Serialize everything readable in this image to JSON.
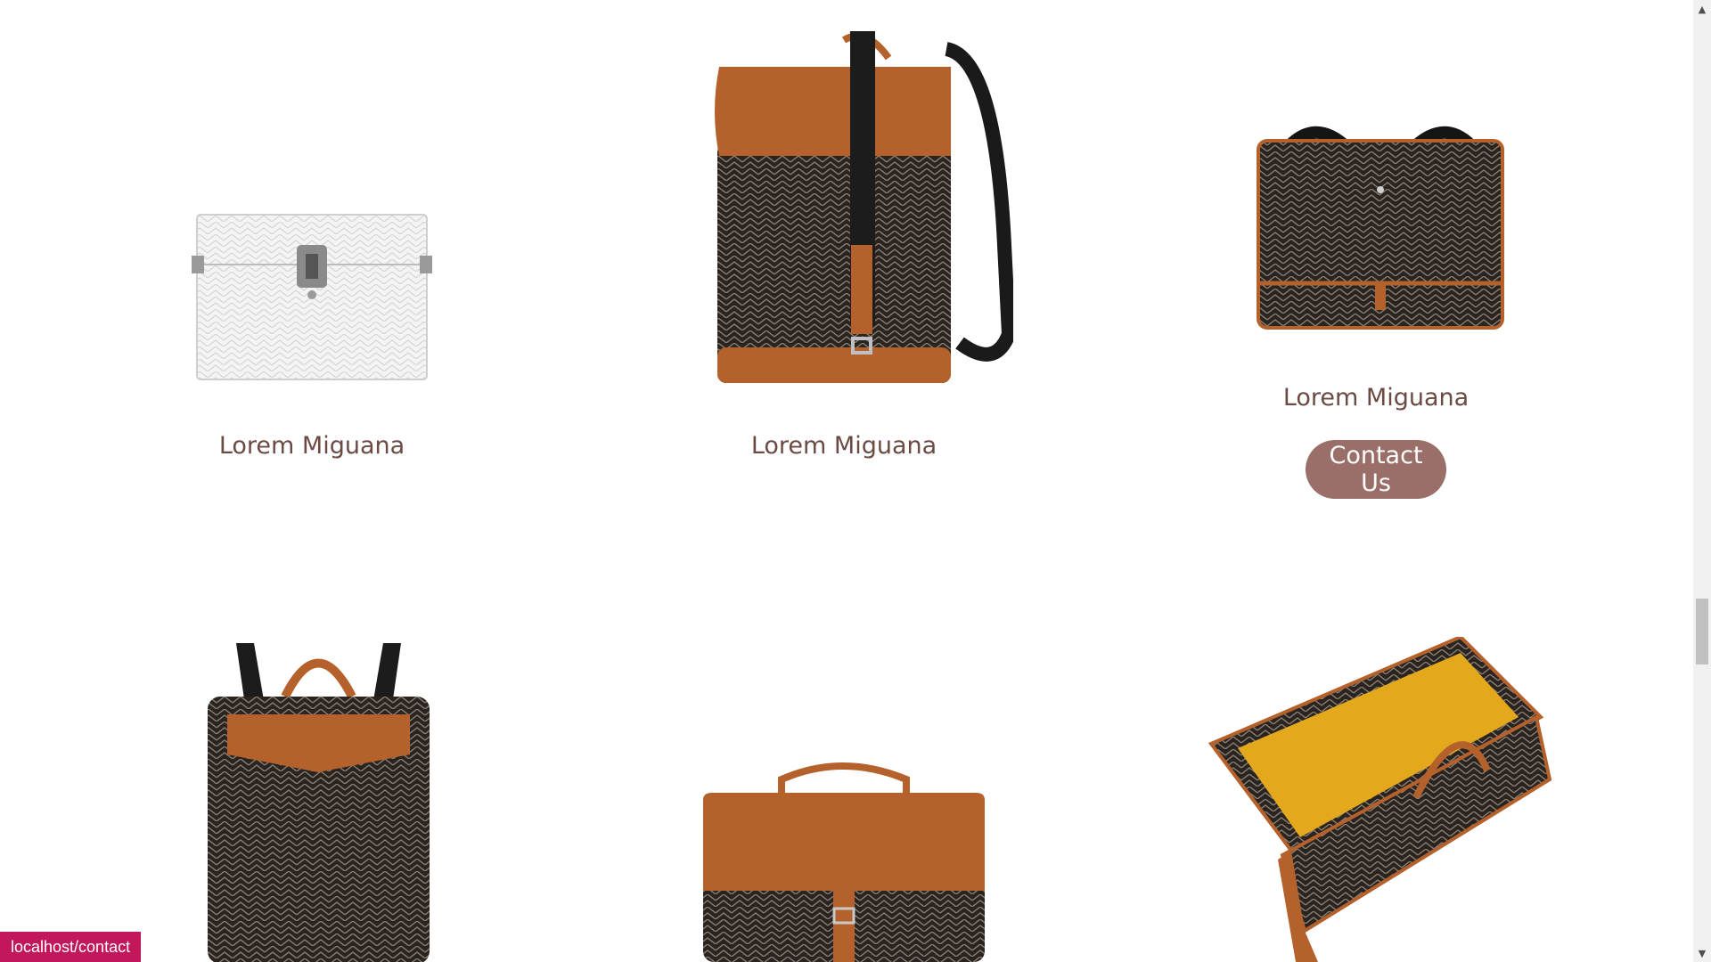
{
  "products": {
    "row1": [
      {
        "name": "Lorem Miguana",
        "image_icon": "white-trunk-case-image"
      },
      {
        "name": "Lorem Miguana",
        "image_icon": "goyard-backpack-image"
      },
      {
        "name": "Lorem Miguana",
        "image_icon": "messenger-bag-image",
        "cta_label": "Contact Us"
      }
    ],
    "row2": [
      {
        "image_icon": "flat-backpack-image"
      },
      {
        "image_icon": "leather-flap-bag-image"
      },
      {
        "image_icon": "open-trunk-case-image"
      }
    ]
  },
  "colors": {
    "accent": "#9b6f69",
    "text": "#6b4a44",
    "goyard_dark": "#2a2421",
    "leather": "#b5612b",
    "status_bar": "#c2185b"
  },
  "status_bar": {
    "url": "localhost/contact"
  }
}
